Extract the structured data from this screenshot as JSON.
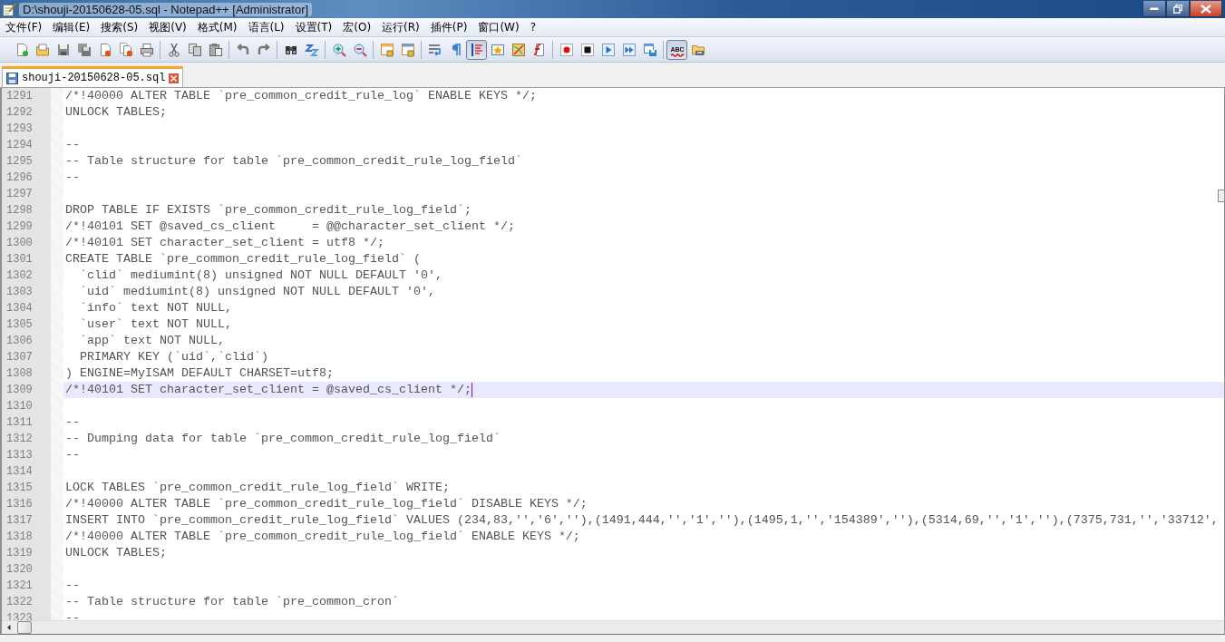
{
  "window": {
    "title": "D:\\shouji-20150628-05.sql - Notepad++ [Administrator]"
  },
  "menu": [
    "文件(F)",
    "编辑(E)",
    "搜索(S)",
    "视图(V)",
    "格式(M)",
    "语言(L)",
    "设置(T)",
    "宏(O)",
    "运行(R)",
    "插件(P)",
    "窗口(W)",
    "?"
  ],
  "toolbar": [
    {
      "kind": "new",
      "pressed": false
    },
    {
      "kind": "open",
      "pressed": false
    },
    {
      "kind": "save",
      "pressed": false
    },
    {
      "kind": "save-all",
      "pressed": false
    },
    {
      "kind": "close",
      "pressed": false
    },
    {
      "kind": "close-all",
      "pressed": false
    },
    {
      "kind": "print",
      "pressed": false
    },
    {
      "kind": "separator"
    },
    {
      "kind": "cut",
      "pressed": false
    },
    {
      "kind": "copy",
      "pressed": false
    },
    {
      "kind": "paste",
      "pressed": false
    },
    {
      "kind": "separator"
    },
    {
      "kind": "undo",
      "pressed": false
    },
    {
      "kind": "redo",
      "pressed": false
    },
    {
      "kind": "separator"
    },
    {
      "kind": "find",
      "pressed": false
    },
    {
      "kind": "replace",
      "pressed": false
    },
    {
      "kind": "separator"
    },
    {
      "kind": "zoom-in",
      "pressed": false
    },
    {
      "kind": "zoom-out",
      "pressed": false
    },
    {
      "kind": "separator"
    },
    {
      "kind": "sync-v",
      "pressed": false
    },
    {
      "kind": "sync-h",
      "pressed": false
    },
    {
      "kind": "separator"
    },
    {
      "kind": "wrap",
      "pressed": false
    },
    {
      "kind": "all-chars",
      "pressed": false
    },
    {
      "kind": "indent-guide",
      "pressed": true
    },
    {
      "kind": "udl",
      "pressed": false
    },
    {
      "kind": "doc-map",
      "pressed": false
    },
    {
      "kind": "func-list",
      "pressed": false
    },
    {
      "kind": "separator"
    },
    {
      "kind": "record",
      "pressed": false
    },
    {
      "kind": "stop",
      "pressed": false
    },
    {
      "kind": "play",
      "pressed": false
    },
    {
      "kind": "play-multi",
      "pressed": false
    },
    {
      "kind": "save-macro",
      "pressed": false
    },
    {
      "kind": "separator"
    },
    {
      "kind": "spellcheck",
      "pressed": true,
      "label": "ABC"
    },
    {
      "kind": "folder-disk",
      "pressed": false
    }
  ],
  "tabs": [
    {
      "label": "shouji-20150628-05.sql",
      "selected": true
    }
  ],
  "editor": {
    "lines": [
      {
        "number": "1291",
        "text": "/*!40000 ALTER TABLE `pre_common_credit_rule_log` ENABLE KEYS */;",
        "current": false
      },
      {
        "number": "1292",
        "text": "UNLOCK TABLES;",
        "current": false
      },
      {
        "number": "1293",
        "current": false
      },
      {
        "number": "1294",
        "text": "--",
        "current": false
      },
      {
        "number": "1295",
        "text": "-- Table structure for table `pre_common_credit_rule_log_field`",
        "current": false
      },
      {
        "number": "1296",
        "text": "--",
        "current": false
      },
      {
        "number": "1297",
        "current": false
      },
      {
        "number": "1298",
        "text": "DROP TABLE IF EXISTS `pre_common_credit_rule_log_field`;",
        "current": false
      },
      {
        "number": "1299",
        "text": "/*!40101 SET @saved_cs_client     = @@character_set_client */;",
        "current": false
      },
      {
        "number": "1300",
        "text": "/*!40101 SET character_set_client = utf8 */;",
        "current": false
      },
      {
        "number": "1301",
        "text": "CREATE TABLE `pre_common_credit_rule_log_field` (",
        "current": false
      },
      {
        "number": "1302",
        "text": "  `clid` mediumint(8) unsigned NOT NULL DEFAULT '0',",
        "current": false
      },
      {
        "number": "1303",
        "text": "  `uid` mediumint(8) unsigned NOT NULL DEFAULT '0',",
        "current": false
      },
      {
        "number": "1304",
        "text": "  `info` text NOT NULL,",
        "current": false
      },
      {
        "number": "1305",
        "text": "  `user` text NOT NULL,",
        "current": false
      },
      {
        "number": "1306",
        "text": "  `app` text NOT NULL,",
        "current": false
      },
      {
        "number": "1307",
        "text": "  PRIMARY KEY (`uid`,`clid`)",
        "current": false
      },
      {
        "number": "1308",
        "text": ") ENGINE=MyISAM DEFAULT CHARSET=utf8;",
        "current": false
      },
      {
        "number": "1309",
        "text": "/*!40101 SET character_set_client = @saved_cs_client */;",
        "current": true
      },
      {
        "number": "1310",
        "current": false
      },
      {
        "number": "1311",
        "text": "--",
        "current": false
      },
      {
        "number": "1312",
        "text": "-- Dumping data for table `pre_common_credit_rule_log_field`",
        "current": false
      },
      {
        "number": "1313",
        "text": "--",
        "current": false
      },
      {
        "number": "1314",
        "current": false
      },
      {
        "number": "1315",
        "text": "LOCK TABLES `pre_common_credit_rule_log_field` WRITE;",
        "current": false
      },
      {
        "number": "1316",
        "text": "/*!40000 ALTER TABLE `pre_common_credit_rule_log_field` DISABLE KEYS */;",
        "current": false
      },
      {
        "number": "1317",
        "text": "INSERT INTO `pre_common_credit_rule_log_field` VALUES (234,83,'','6',''),(1491,444,'','1',''),(1495,1,'','154389',''),(5314,69,'','1',''),(7375,731,'','33712',",
        "current": false
      },
      {
        "number": "1318",
        "text": "/*!40000 ALTER TABLE `pre_common_credit_rule_log_field` ENABLE KEYS */;",
        "current": false
      },
      {
        "number": "1319",
        "text": "UNLOCK TABLES;",
        "current": false
      },
      {
        "number": "1320",
        "current": false
      },
      {
        "number": "1321",
        "text": "--",
        "current": false
      },
      {
        "number": "1322",
        "text": "-- Table structure for table `pre_common_cron`",
        "current": false
      },
      {
        "number": "1323",
        "text": "--",
        "current": false
      }
    ]
  }
}
